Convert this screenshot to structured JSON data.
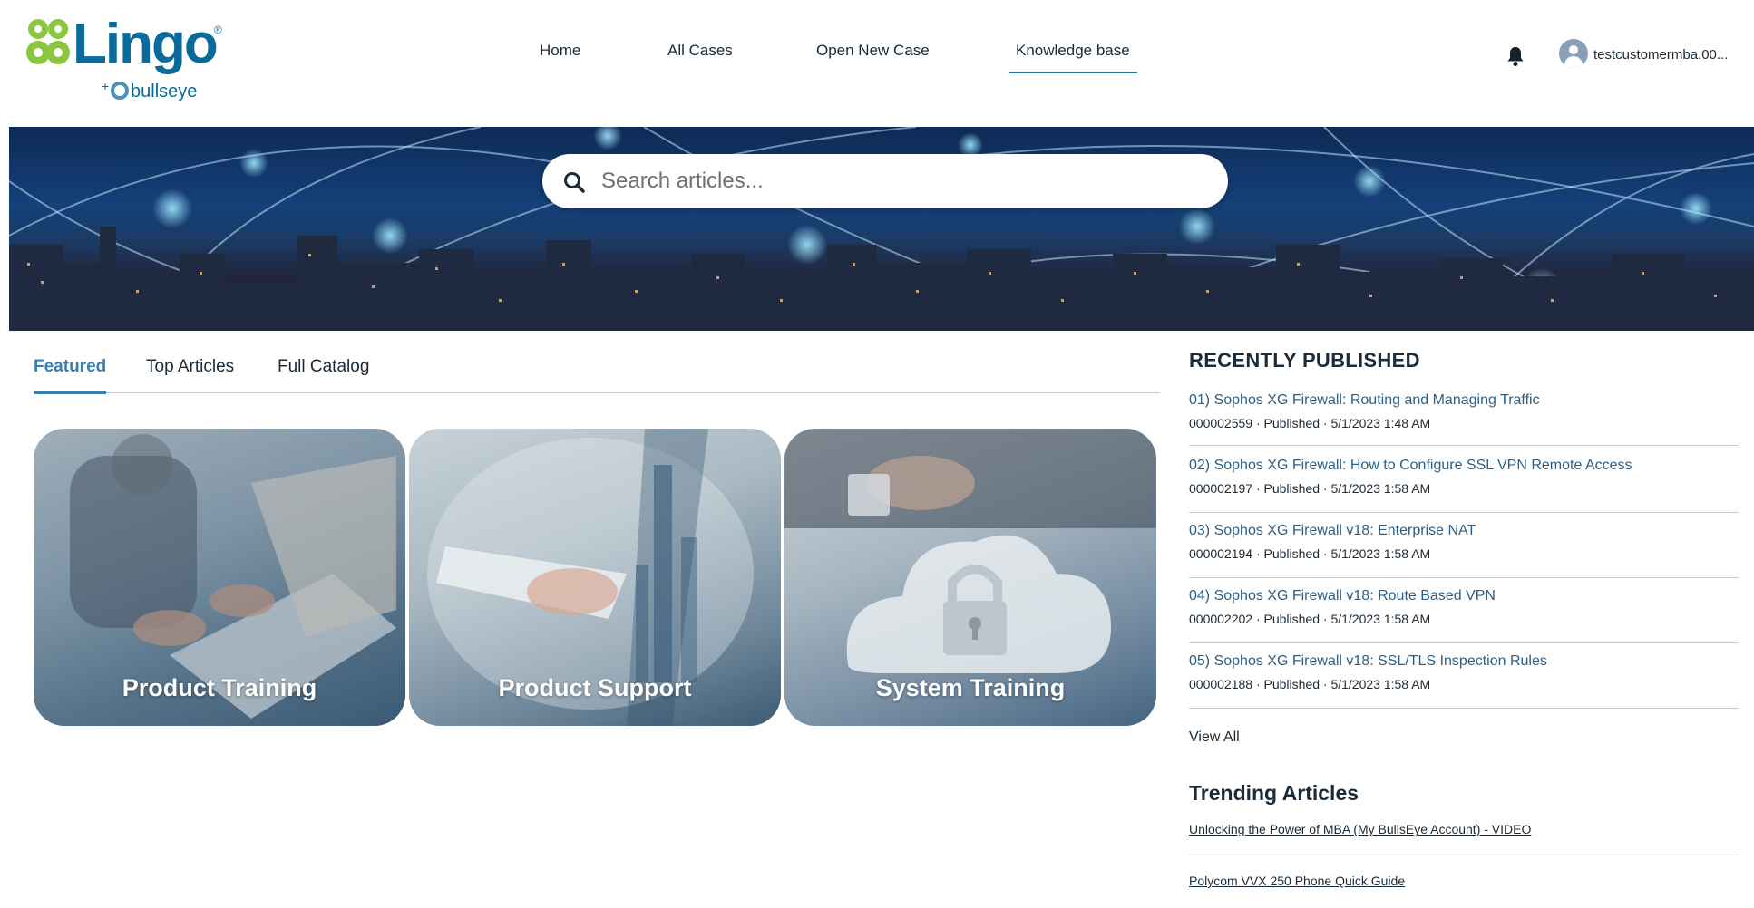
{
  "brand": {
    "name": "Lingo",
    "registered": "®",
    "sub_plus": "+",
    "sub_name": "bullseye",
    "colors": {
      "primary": "#0a6b9b",
      "green": "#8cc63f"
    }
  },
  "nav": {
    "items": [
      {
        "label": "Home"
      },
      {
        "label": "All Cases"
      },
      {
        "label": "Open New Case"
      },
      {
        "label": "Knowledge base",
        "active": true
      }
    ]
  },
  "user": {
    "name": "testcustomermba.00...",
    "notification_icon": "bell-icon",
    "avatar_icon": "user-avatar-icon"
  },
  "search": {
    "placeholder": "Search articles...",
    "value": "",
    "icon": "search-icon"
  },
  "tabs": {
    "items": [
      {
        "label": "Featured",
        "active": true
      },
      {
        "label": "Top Articles"
      },
      {
        "label": "Full Catalog"
      }
    ]
  },
  "cards": [
    {
      "label": "Product Training"
    },
    {
      "label": "Product Support"
    },
    {
      "label": "System Training"
    }
  ],
  "recently_published": {
    "title": "RECENTLY PUBLISHED",
    "items": [
      {
        "title": "01) Sophos XG Firewall: Routing and Managing Traffic",
        "meta": "000002559 · Published · 5/1/2023 1:48 AM"
      },
      {
        "title": "02) Sophos XG Firewall: How to Configure SSL VPN Remote Access",
        "meta": "000002197 · Published · 5/1/2023 1:58 AM"
      },
      {
        "title": "03) Sophos XG Firewall v18: Enterprise NAT",
        "meta": "000002194 · Published · 5/1/2023 1:58 AM"
      },
      {
        "title": "04) Sophos XG Firewall v18: Route Based VPN",
        "meta": "000002202 · Published · 5/1/2023 1:58 AM"
      },
      {
        "title": "05) Sophos XG Firewall v18: SSL/TLS Inspection Rules",
        "meta": "000002188 · Published · 5/1/2023 1:58 AM"
      }
    ],
    "view_all": "View All"
  },
  "trending": {
    "title": "Trending Articles",
    "items": [
      {
        "label": "Unlocking the Power of MBA (My BullsEye Account) - VIDEO"
      },
      {
        "label": "Polycom VVX 250 Phone Quick Guide"
      }
    ]
  }
}
